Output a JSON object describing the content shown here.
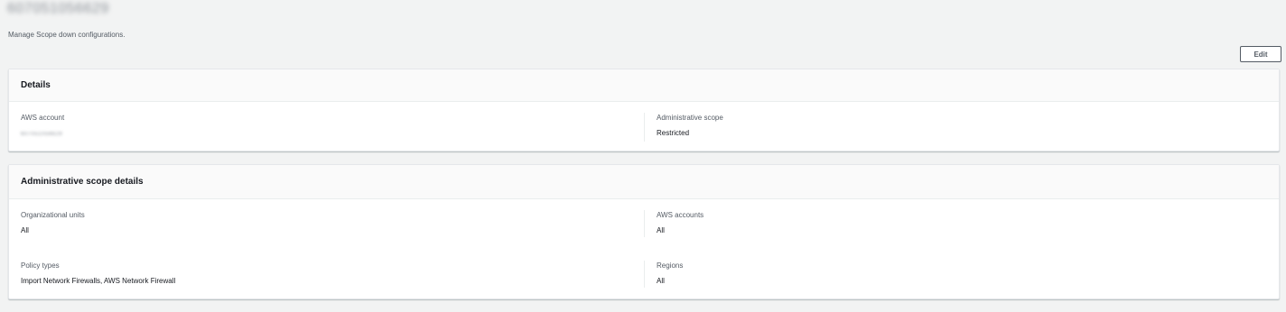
{
  "page": {
    "title": "607051056629",
    "description": "Manage Scope down configurations.",
    "edit_label": "Edit"
  },
  "details": {
    "title": "Details",
    "aws_account_label": "AWS account",
    "aws_account_value": "607051056629",
    "admin_scope_label": "Administrative scope",
    "admin_scope_value": "Restricted"
  },
  "scope_details": {
    "title": "Administrative scope details",
    "org_units_label": "Organizational units",
    "org_units_value": "All",
    "aws_accounts_label": "AWS accounts",
    "aws_accounts_value": "All",
    "policy_types_label": "Policy types",
    "policy_types_value": "Import Network Firewalls, AWS Network Firewall",
    "regions_label": "Regions",
    "regions_value": "All"
  }
}
